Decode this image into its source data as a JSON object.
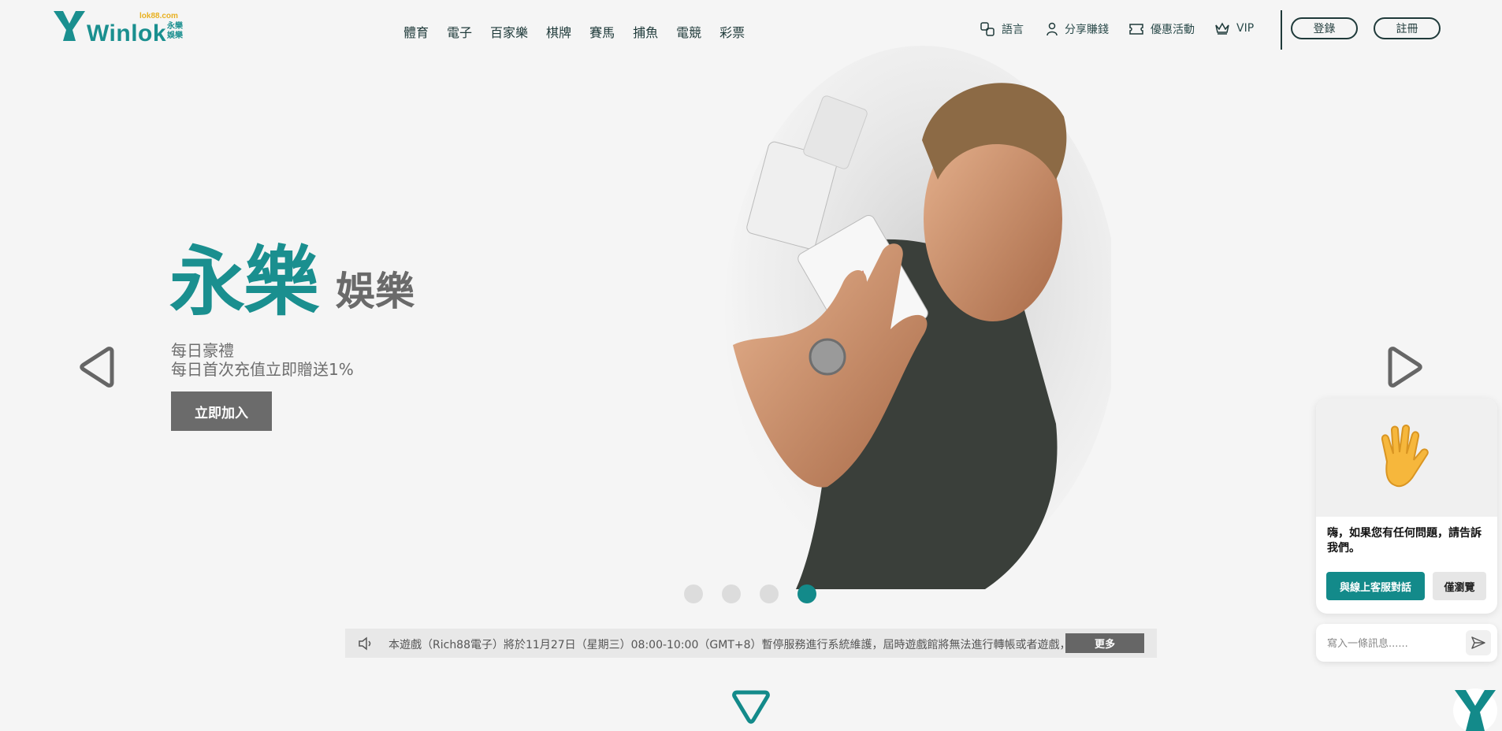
{
  "logo": {
    "brand": "Winlok",
    "domain": "lok88.com",
    "subtitle": "永樂娛樂"
  },
  "nav": [
    "體育",
    "電子",
    "百家樂",
    "棋牌",
    "賽馬",
    "捕魚",
    "電競",
    "彩票"
  ],
  "utilities": {
    "language": "語言",
    "share": "分享賺錢",
    "promotions": "優惠活動",
    "vip": "VIP"
  },
  "auth": {
    "login": "登錄",
    "register": "註冊"
  },
  "hero": {
    "title": "永樂",
    "title_suffix": "娛樂",
    "line1": "每日豪禮",
    "line2": "每日首次充值立即贈送1%",
    "cta": "立即加入"
  },
  "carousel": {
    "slides": 4,
    "active": 4
  },
  "notice": {
    "text": "本遊戲（Rich88電子）將於11月27日（星期三）08:00-10:00（GMT+8）暫停服務進行系統維護，屆時遊戲館將無法進行轉帳或者遊戲，",
    "more": "更多"
  },
  "chat": {
    "message": "嗨，如果您有任何問題，請告訴我們。",
    "talk_button": "與線上客服對話",
    "browse_button": "僅瀏覽",
    "input_placeholder": "寫入一條訊息......"
  },
  "colors": {
    "brand": "#138a8a",
    "dark": "#1f3a3a",
    "gold": "#e8b020"
  }
}
